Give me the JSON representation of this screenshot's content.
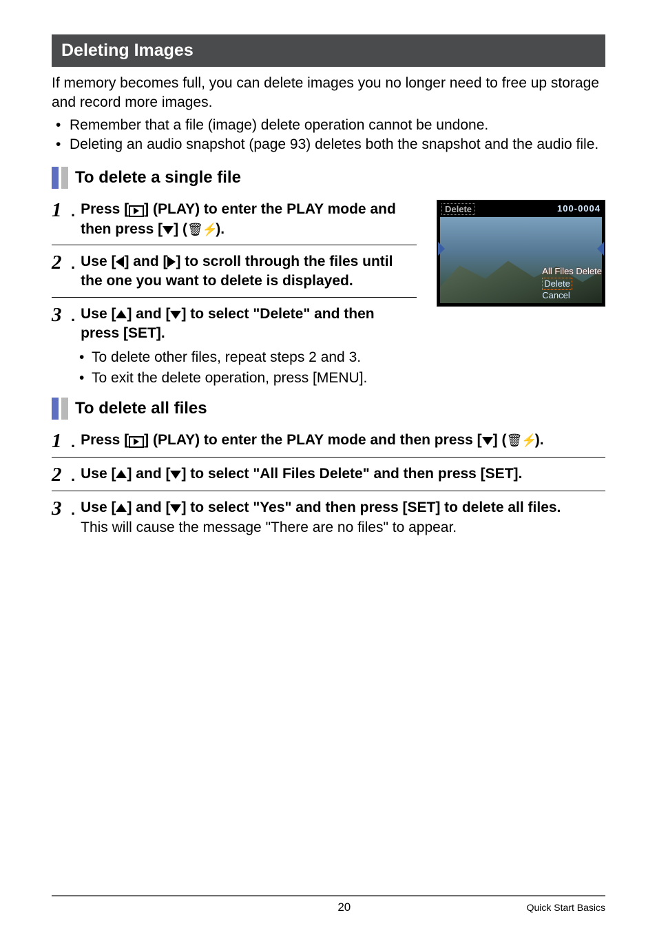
{
  "section": {
    "title": "Deleting Images",
    "intro": "If memory becomes full, you can delete images you no longer need to free up storage and record more images.",
    "bullets": [
      "Remember that a file (image) delete operation cannot be undone.",
      "Deleting an audio snapshot (page 93) deletes both the snapshot and the audio file."
    ]
  },
  "single": {
    "title": "To delete a single file",
    "step1a": "Press [",
    "step1b": "] (PLAY) to enter the PLAY mode and then press [",
    "step1c": "] (",
    "step1d": ").",
    "step2a": "Use [",
    "step2b": "] and [",
    "step2c": "] to scroll through the files until the one you want to delete is displayed.",
    "step3a": "Use [",
    "step3b": "] and [",
    "step3c": "] to select \"Delete\" and then press [SET].",
    "sub_bullets": [
      "To delete other files, repeat steps 2 and 3.",
      "To exit the delete operation, press [MENU]."
    ]
  },
  "all": {
    "title": "To delete all files",
    "step1a": "Press [",
    "step1b": "] (PLAY) to enter the PLAY mode and then press [",
    "step1c": "] (",
    "step1d": ").",
    "step2a": "Use [",
    "step2b": "] and [",
    "step2c": "] to select \"All Files Delete\" and then press [SET].",
    "step3a": "Use [",
    "step3b": "] and [",
    "step3c": "] to select \"Yes\" and then press [SET] to delete all files.",
    "step3_plain": "This will cause the message \"There are no files\" to appear."
  },
  "screenshot": {
    "top_label": "Delete",
    "counter": "100-0004",
    "menu": {
      "all": "All Files Delete",
      "delete": "Delete",
      "cancel": "Cancel"
    }
  },
  "glyphs": {
    "trash_flash": "🗑 ⚡"
  },
  "footer": {
    "page": "20",
    "label": "Quick Start Basics"
  }
}
